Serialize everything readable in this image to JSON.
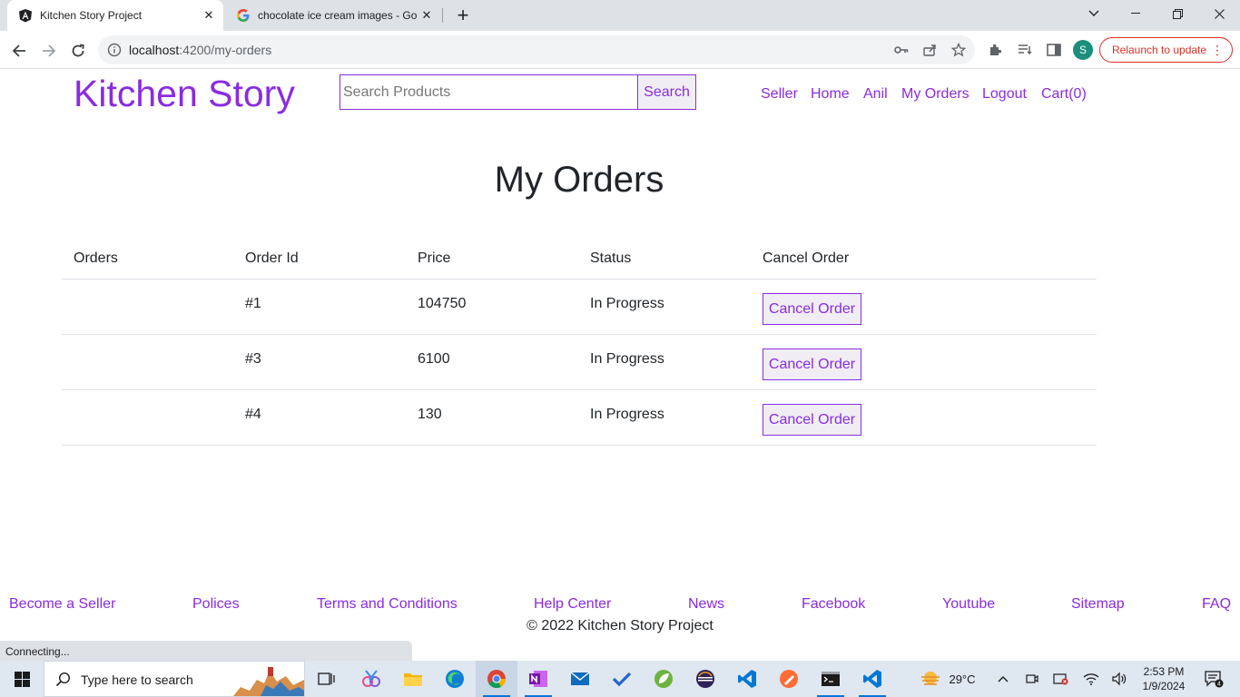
{
  "browser": {
    "tabs": [
      {
        "title": "Kitchen Story Project",
        "icon": "angular-icon",
        "active": true
      },
      {
        "title": "chocolate ice cream images - Go",
        "icon": "google-icon",
        "active": false
      }
    ],
    "url_host": "localhost",
    "url_path": ":4200/my-orders",
    "relaunch_label": "Relaunch to update",
    "profile_initial": "S",
    "status_text": "Connecting..."
  },
  "header": {
    "brand": "Kitchen Story",
    "search_placeholder": "Search Products",
    "search_button": "Search",
    "nav": [
      "Seller",
      "Home",
      "Anil",
      "My Orders",
      "Logout",
      "Cart(0)"
    ]
  },
  "page": {
    "title": "My Orders",
    "columns": [
      "Orders",
      "Order Id",
      "Price",
      "Status",
      "Cancel Order"
    ],
    "orders": [
      {
        "order": "",
        "id": "#1",
        "price": "104750",
        "status": "In Progress",
        "action": "Cancel Order"
      },
      {
        "order": "",
        "id": "#3",
        "price": "6100",
        "status": "In Progress",
        "action": "Cancel Order"
      },
      {
        "order": "",
        "id": "#4",
        "price": "130",
        "status": "In Progress",
        "action": "Cancel Order"
      }
    ]
  },
  "footer": {
    "links": [
      "Become a Seller",
      "Polices",
      "Terms and Conditions",
      "Help Center",
      "News",
      "Facebook",
      "Youtube",
      "Sitemap",
      "FAQ"
    ],
    "copyright": "© 2022 Kitchen Story Project"
  },
  "taskbar": {
    "search_placeholder": "Type here to search",
    "weather": "29°C",
    "time": "2:53 PM",
    "date": "1/9/2024",
    "notification_count": "4"
  },
  "colors": {
    "accent": "#8a2be2",
    "text": "#212529",
    "relaunch": "#d93025"
  }
}
